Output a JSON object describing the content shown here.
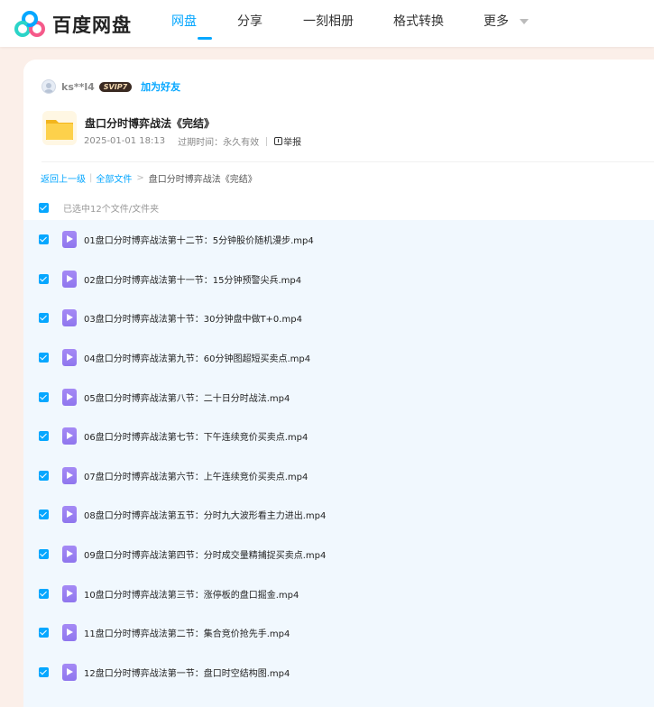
{
  "app": {
    "brand": "百度网盘",
    "brand_colors": {
      "blue": "#06a7ff",
      "teal": "#2bd4c8",
      "pink": "#f55a8a"
    }
  },
  "nav": {
    "items": [
      {
        "label": "网盘",
        "active": true
      },
      {
        "label": "分享",
        "active": false
      },
      {
        "label": "一刻相册",
        "active": false
      },
      {
        "label": "格式转换",
        "active": false
      },
      {
        "label": "更多",
        "active": false
      }
    ]
  },
  "share": {
    "sharer_name": "ks**l4",
    "vip_badge": "SVIP7",
    "add_friend": "加为好友",
    "title": "盘口分时博弈战法《完结》",
    "date": "2025-01-01 18:13",
    "expire": "过期时间：永久有效",
    "report": "举报"
  },
  "breadcrumb": {
    "back": "返回上一级",
    "sep_bar": "|",
    "all_files": "全部文件",
    "sep_arrow": ">",
    "current": "盘口分时博弈战法《完结》"
  },
  "selection": {
    "text": "已选中12个文件/文件夹"
  },
  "files": [
    {
      "name": "01盘口分时博弈战法第十二节：5分钟股价随机漫步.mp4",
      "checked": true,
      "icon": "video-file-icon"
    },
    {
      "name": "02盘口分时博弈战法第十一节：15分钟预警尖兵.mp4",
      "checked": true,
      "icon": "video-file-icon"
    },
    {
      "name": "03盘口分时博弈战法第十节：30分钟盘中做T+0.mp4",
      "checked": true,
      "icon": "video-file-icon"
    },
    {
      "name": "04盘口分时博弈战法第九节：60分钟图超短买卖点.mp4",
      "checked": true,
      "icon": "video-file-icon"
    },
    {
      "name": "05盘口分时博弈战法第八节：二十日分时战法.mp4",
      "checked": true,
      "icon": "video-file-icon"
    },
    {
      "name": "06盘口分时博弈战法第七节：下午连续竞价买卖点.mp4",
      "checked": true,
      "icon": "video-file-icon"
    },
    {
      "name": "07盘口分时博弈战法第六节：上午连续竞价买卖点.mp4",
      "checked": true,
      "icon": "video-file-icon"
    },
    {
      "name": "08盘口分时博弈战法第五节：分时九大波形看主力进出.mp4",
      "checked": true,
      "icon": "video-file-icon"
    },
    {
      "name": "09盘口分时博弈战法第四节：分时成交量精捕捉买卖点.mp4",
      "checked": true,
      "icon": "video-file-icon"
    },
    {
      "name": "10盘口分时博弈战法第三节：涨停板的盘口掘金.mp4",
      "checked": true,
      "icon": "video-file-icon"
    },
    {
      "name": "11盘口分时博弈战法第二节：集合竞价抢先手.mp4",
      "checked": true,
      "icon": "video-file-icon"
    },
    {
      "name": "12盘口分时博弈战法第一节：盘口时空结构图.mp4",
      "checked": true,
      "icon": "video-file-icon"
    }
  ]
}
